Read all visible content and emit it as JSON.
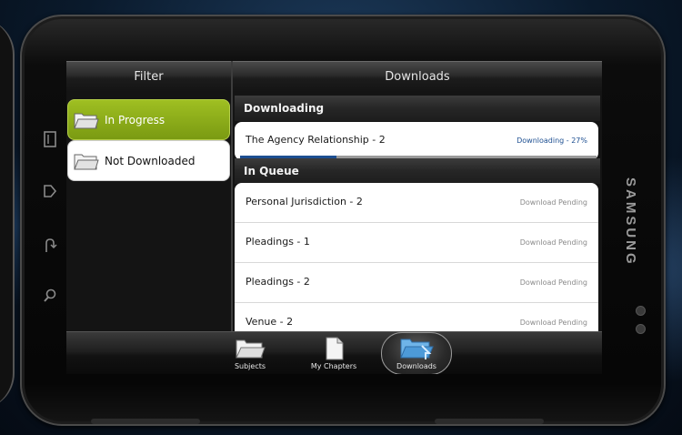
{
  "brand": "SAMSUNG",
  "filter": {
    "header": "Filter",
    "items": [
      {
        "label": "In Progress",
        "state": "active"
      },
      {
        "label": "Not Downloaded",
        "state": "idle"
      }
    ]
  },
  "downloads": {
    "header": "Downloads",
    "downloading_title": "Downloading",
    "active_item": {
      "title": "The Agency Relationship - 2",
      "status": "Downloading - 27%",
      "progress": 0.27
    },
    "queue_title": "In Queue",
    "queue": [
      {
        "title": "Personal Jurisdiction - 2",
        "status": "Download Pending"
      },
      {
        "title": "Pleadings - 1",
        "status": "Download Pending"
      },
      {
        "title": "Pleadings - 2",
        "status": "Download Pending"
      },
      {
        "title": "Venue - 2",
        "status": "Download Pending"
      }
    ]
  },
  "tabbar": {
    "tabs": [
      {
        "label": "Subjects",
        "icon": "folder-icon"
      },
      {
        "label": "My Chapters",
        "icon": "document-icon"
      },
      {
        "label": "Downloads",
        "icon": "download-folder-icon",
        "active": true
      }
    ]
  },
  "colors": {
    "accent_green": "#8fb01a",
    "progress_blue": "#1d4f91",
    "status_blue": "#1d4f91"
  }
}
